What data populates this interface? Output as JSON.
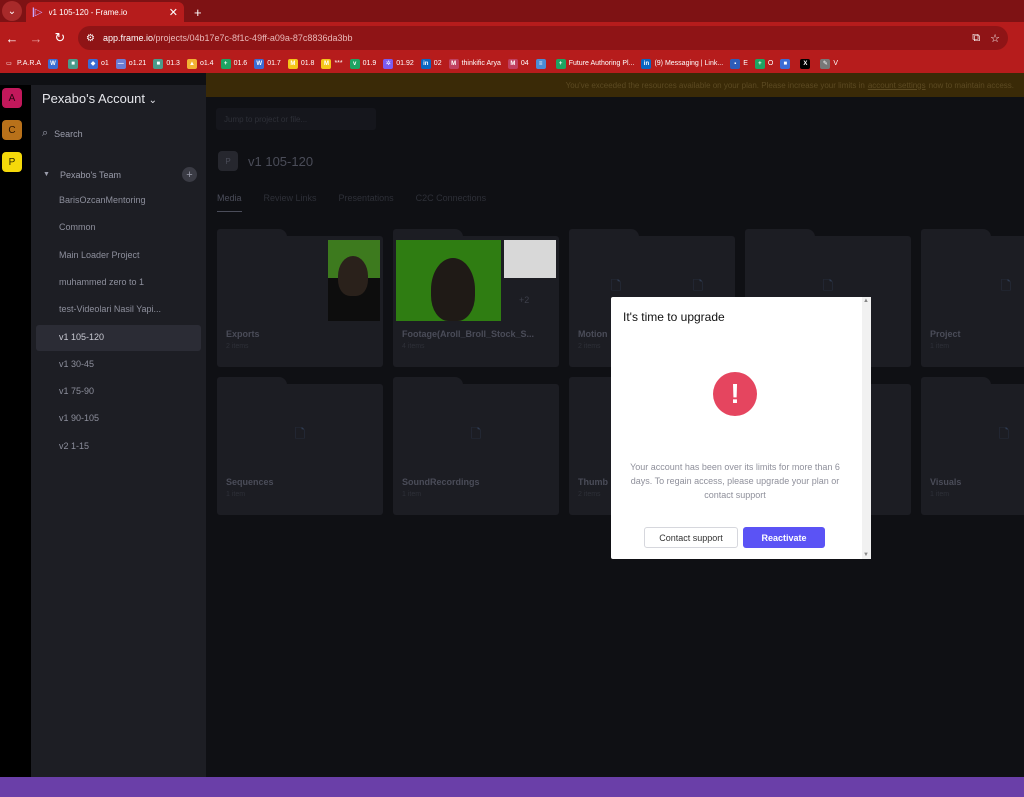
{
  "browser": {
    "tab_title": "v1 105-120 - Frame.io",
    "tab_close": "✕",
    "new_tab": "+",
    "url_host": "app.frame.io",
    "url_path": "/projects/04b17e7c-8f1c-49ff-a09a-87c8836da3bb",
    "bookmarks": [
      {
        "label": "P.A.R.A",
        "icon": "folder-icon",
        "color": "#b61c1c"
      },
      {
        "label": "",
        "icon": "wordpress-icon",
        "color": "#3b6cd4"
      },
      {
        "label": "",
        "icon": "box-icon",
        "color": "#4a9a8a"
      },
      {
        "label": "o1",
        "icon": "shield-icon",
        "color": "#3b6cd4"
      },
      {
        "label": "o1.21",
        "icon": "dash-icon",
        "color": "#6b7cd4"
      },
      {
        "label": "01.3",
        "icon": "box-icon",
        "color": "#4a9a8a"
      },
      {
        "label": "o1.4",
        "icon": "drive-icon",
        "color": "#f2b233"
      },
      {
        "label": "01.6",
        "icon": "sheets-icon",
        "color": "#1ea362"
      },
      {
        "label": "01.7",
        "icon": "wordpress-icon",
        "color": "#3b6cd4"
      },
      {
        "label": "01.8",
        "icon": "m-icon",
        "color": "#f5c518"
      },
      {
        "label": "***",
        "icon": "m-icon",
        "color": "#f5c518"
      },
      {
        "label": "01.9",
        "icon": "vp-icon",
        "color": "#1ea362"
      },
      {
        "label": "01.92",
        "icon": "gear-icon",
        "color": "#7a5cf0"
      },
      {
        "label": "02",
        "icon": "linkedin-icon",
        "color": "#0a66c2"
      },
      {
        "label": "thinkific Arya",
        "icon": "gmail-icon",
        "color": "#c04060"
      },
      {
        "label": "04",
        "icon": "gmail-icon",
        "color": "#c04060"
      },
      {
        "label": "",
        "icon": "forms-icon",
        "color": "#4a8cd4"
      },
      {
        "label": "Future Authoring Pl...",
        "icon": "sheets-icon",
        "color": "#1ea362"
      },
      {
        "label": "(9) Messaging | Link...",
        "icon": "linkedin-icon",
        "color": "#0a66c2"
      },
      {
        "label": "E",
        "icon": "app-icon",
        "color": "#2d5cb8"
      },
      {
        "label": "O",
        "icon": "sheets-icon",
        "color": "#1ea362"
      },
      {
        "label": "",
        "icon": "box-icon",
        "color": "#3b6cd4"
      },
      {
        "label": "",
        "icon": "x-icon",
        "color": "#000000"
      },
      {
        "label": "V",
        "icon": "pen-icon",
        "color": "#777777"
      }
    ]
  },
  "rail": {
    "workspaces": [
      {
        "letter": "A",
        "bg": "#c2185b",
        "fg": "#2a0010"
      },
      {
        "letter": "C",
        "bg": "#b8711a",
        "fg": "#2a1400"
      },
      {
        "letter": "P",
        "bg": "#f5d90a",
        "fg": "#2a2400"
      }
    ]
  },
  "sidebar": {
    "account": "Pexabo's Account",
    "account_chevron": "⌄",
    "search": "Search",
    "team": "Pexabo's Team",
    "team_add": "+",
    "projects": [
      "BarisOzcanMentoring",
      "Common",
      "Main Loader Project",
      "muhammed zero to 1",
      "test-Videolari Nasil Yapi...",
      "v1 105-120",
      "v1 30-45",
      "v1 75-90",
      "v1 90-105",
      "v2 1-15"
    ],
    "active_index": 5
  },
  "main": {
    "banner_text": "You've exceeded the resources available on your plan. Please increase your limits in",
    "banner_link": "account settings",
    "banner_tail": "now to maintain access.",
    "jump_placeholder": "Jump to project or file...",
    "project_badge": "P",
    "project_title": "v1 105-120",
    "tabs": [
      "Media",
      "Review Links",
      "Presentations",
      "C2C Connections"
    ],
    "active_tab": 0,
    "folders": [
      {
        "name": "Exports",
        "count": "2 items"
      },
      {
        "name": "Footage(Aroll_Broll_Stock_S...",
        "count": "4 items",
        "more": "+2"
      },
      {
        "name": "Motion",
        "count": "2 items"
      },
      {
        "name": "",
        "count": ""
      },
      {
        "name": "Project",
        "count": "1 item"
      },
      {
        "name": "Sequences",
        "count": "1 item"
      },
      {
        "name": "SoundRecordings",
        "count": "1 item"
      },
      {
        "name": "Thumb",
        "count": "2 items"
      },
      {
        "name": "",
        "count": ""
      },
      {
        "name": "Visuals",
        "count": "1 item"
      }
    ]
  },
  "modal": {
    "title": "It's time to upgrade",
    "alert_symbol": "!",
    "message": "Your account has been over its limits for more than 6 days. To regain access, please upgrade your plan or contact support",
    "contact_label": "Contact support",
    "reactivate_label": "Reactivate"
  },
  "colors": {
    "accent": "#5b53f5",
    "alert": "#e5455f",
    "browser_red": "#b61c1c"
  }
}
